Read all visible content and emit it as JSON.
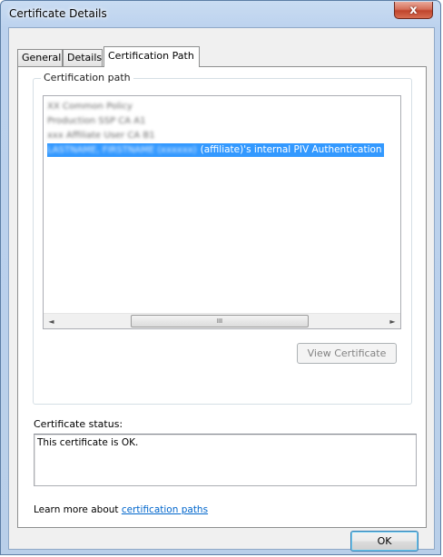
{
  "window": {
    "title": "Certificate Details",
    "close_glyph": "x"
  },
  "tabs": [
    {
      "label": "General",
      "active": false
    },
    {
      "label": "Details",
      "active": false
    },
    {
      "label": "Certification Path",
      "active": true
    }
  ],
  "cert_path": {
    "group_label": "Certification path",
    "items": [
      {
        "blurred_text": "XX Common Policy",
        "selected": false,
        "indent": 0
      },
      {
        "blurred_text": "Production SSP CA A1",
        "selected": false,
        "indent": 0
      },
      {
        "blurred_text": "xxx Affiliate User CA B1",
        "selected": false,
        "indent": 0
      },
      {
        "blurred_text": "LASTNAME, FIRSTNAME (xxxxxx)",
        "clear_text": "(affiliate)'s internal PIV Authentication",
        "selected": true,
        "indent": 0
      }
    ],
    "scroll_left_glyph": "◄",
    "scroll_right_glyph": "►",
    "scroll_grip": "III",
    "scroll_position": 0.33,
    "view_button": "View Certificate",
    "view_button_enabled": false
  },
  "status": {
    "label": "Certificate status:",
    "text": "This certificate is OK."
  },
  "learn_more": {
    "prefix": "Learn more about ",
    "link": "certification paths"
  },
  "ok_button": "OK",
  "colors": {
    "selection": "#3399ff",
    "link": "#0066cc",
    "close_button": "#c7503a",
    "frame": "#bcd2ee"
  }
}
